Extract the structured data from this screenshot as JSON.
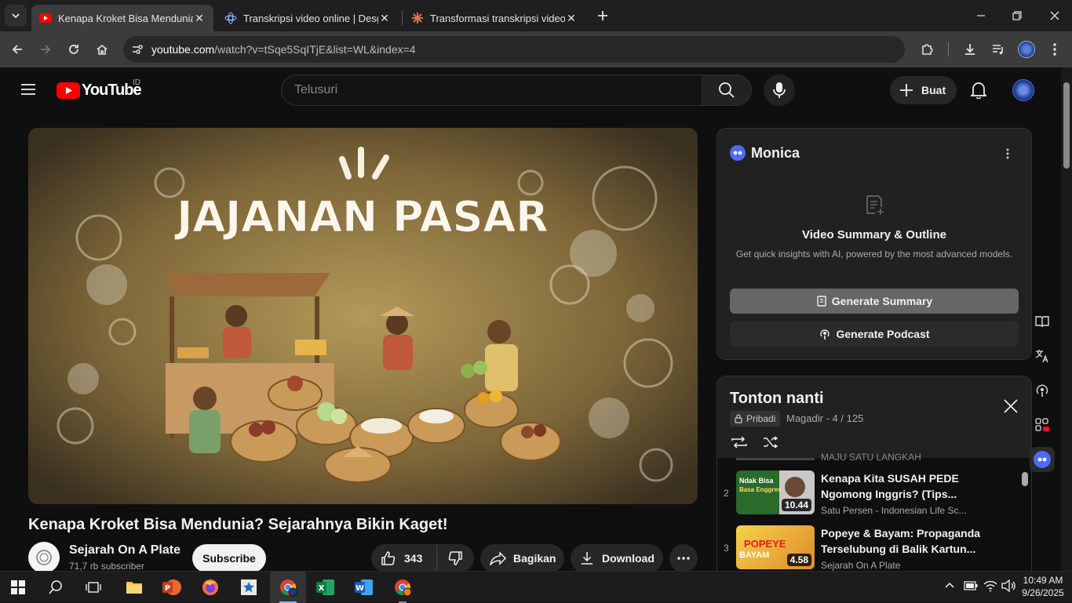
{
  "browser": {
    "tabs": [
      {
        "title": "Kenapa Kroket Bisa Mendunia? Sejarahnya Bikin Kaget!",
        "active": true
      },
      {
        "title": "Transkripsi video online | Desgram",
        "active": false
      },
      {
        "title": "Transformasi transkripsi video menjadi teks",
        "active": false
      }
    ],
    "url_domain": "youtube.com",
    "url_path": "/watch?v=tSqe5SqITjE&list=WL&index=4"
  },
  "youtube": {
    "logo_text": "YouTube",
    "country_code": "ID",
    "search_placeholder": "Telusuri",
    "create_label": "Buat"
  },
  "video": {
    "thumbnail_text": "JAJANAN PASAR",
    "title": "Kenapa Kroket Bisa Mendunia? Sejarahnya Bikin Kaget!",
    "channel": "Sejarah On A Plate",
    "subscribers": "71,7 rb subscriber",
    "subscribe_label": "Subscribe",
    "likes": "343",
    "share_label": "Bagikan",
    "download_label": "Download"
  },
  "monica": {
    "name": "Monica",
    "heading": "Video Summary & Outline",
    "description": "Get quick insights with AI, powered by the most advanced models.",
    "summary_button": "Generate Summary",
    "podcast_button": "Generate Podcast"
  },
  "playlist": {
    "title": "Tonton nanti",
    "privacy": "Pribadi",
    "meta": "Magadir - 4 / 125",
    "partial_item": "MAJU SATU LANGKAH",
    "items": [
      {
        "index": "2",
        "title_line1": "Kenapa Kita SUSAH PEDE",
        "title_line2": "Ngomong Inggris? (Tips...",
        "channel": "Satu Persen - Indonesian Life Sc...",
        "duration": "10.44",
        "thumb_text1": "Ndak Bisa",
        "thumb_text2": "Basa Enggres"
      },
      {
        "index": "3",
        "title_line1": "Popeye & Bayam: Propaganda",
        "title_line2": "Terselubung di Balik Kartun...",
        "channel": "Sejarah On A Plate",
        "duration": "4.58",
        "thumb_text1": "POPEYE",
        "thumb_text2": "BAYAM"
      }
    ]
  },
  "taskbar": {
    "time": "10:49 AM",
    "date": "9/26/2025"
  },
  "colors": {
    "yt_red": "#ff0000",
    "monica_blue": "#4b6bfb"
  }
}
